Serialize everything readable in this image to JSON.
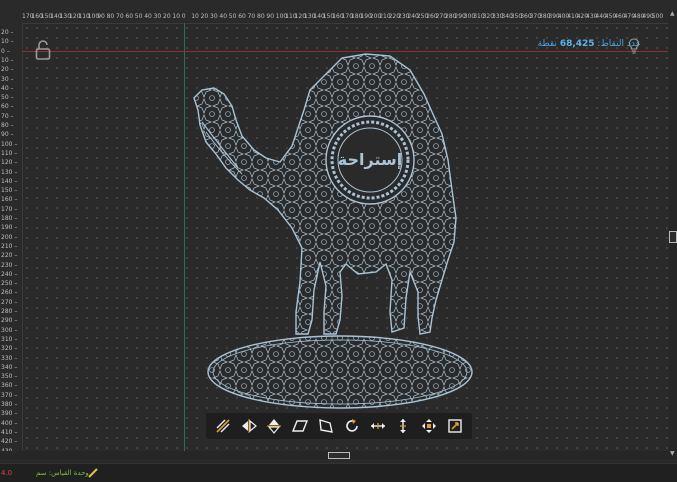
{
  "ruler": {
    "top_labels": [
      "170",
      "160",
      "150",
      "140",
      "130",
      "120",
      "110",
      "100",
      "90",
      "80",
      "70",
      "60",
      "50",
      "40",
      "30",
      "20",
      "10",
      "0",
      "10",
      "20",
      "30",
      "40",
      "50",
      "60",
      "70",
      "80",
      "90",
      "100",
      "110",
      "120",
      "130",
      "140",
      "150",
      "160",
      "170",
      "180",
      "190",
      "200",
      "210",
      "220",
      "230",
      "240",
      "250",
      "260",
      "270",
      "280",
      "290",
      "300",
      "310",
      "320",
      "330",
      "340",
      "350",
      "360",
      "370",
      "380",
      "390",
      "400",
      "410",
      "420",
      "430",
      "440",
      "450",
      "460",
      "470",
      "480",
      "490",
      "500"
    ],
    "left_labels": [
      "20",
      "10",
      "0",
      "10",
      "20",
      "30",
      "40",
      "50",
      "60",
      "70",
      "80",
      "90",
      "100",
      "110",
      "120",
      "130",
      "140",
      "150",
      "160",
      "170",
      "180",
      "190",
      "200",
      "210",
      "220",
      "230",
      "240",
      "250",
      "260",
      "270",
      "280",
      "290",
      "300",
      "310",
      "320",
      "330",
      "340",
      "350",
      "360",
      "370",
      "380",
      "390",
      "400",
      "410",
      "420",
      "430"
    ]
  },
  "info": {
    "label": "عدد النقاط:",
    "count": "68,425",
    "unit": "نقطة"
  },
  "design": {
    "emblem_text": "إستراحة"
  },
  "toolbar": {
    "tools": [
      "mirror-diagonal-icon",
      "flip-horizontal-icon",
      "flip-vertical-icon",
      "skew-icon",
      "distort-icon",
      "rotate-icon",
      "scale-horizontal-icon",
      "scale-vertical-icon",
      "move-all-icon",
      "resize-icon"
    ]
  },
  "status": {
    "coord": "4.0",
    "unit_text": "وحدة القياس: سم"
  },
  "colors": {
    "background": "#2a2a2a",
    "design_stroke": "#a9c4d6",
    "accent_blue": "#4aa3df",
    "origin_red": "#8a3030",
    "origin_green": "#2f6b55",
    "status_green": "#7fbf3f",
    "status_red": "#e04040"
  }
}
